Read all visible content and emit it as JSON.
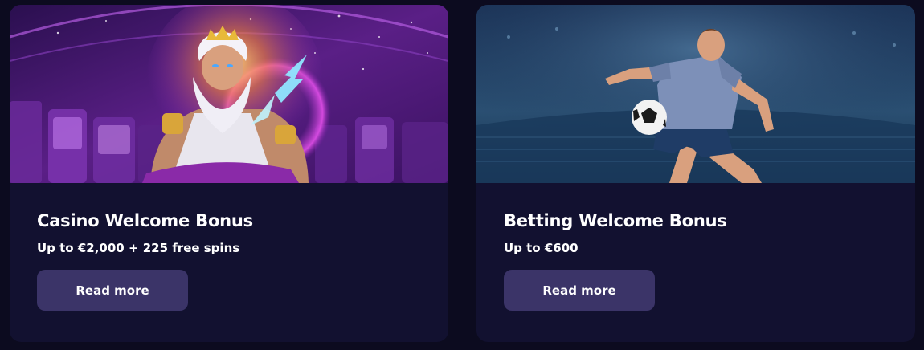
{
  "colors": {
    "page_background": "#0c0b1f",
    "card_background": "#121130",
    "button_background": "#3b3468",
    "text": "#ffffff"
  },
  "cards": [
    {
      "banner_icon": "casino-zeus-banner",
      "title": "Casino Welcome Bonus",
      "subtitle": "Up to €2,000 + 225 free spins",
      "button_label": "Read more"
    },
    {
      "banner_icon": "football-player-banner",
      "title": "Betting Welcome Bonus",
      "subtitle": "Up to €600",
      "button_label": "Read more"
    }
  ]
}
